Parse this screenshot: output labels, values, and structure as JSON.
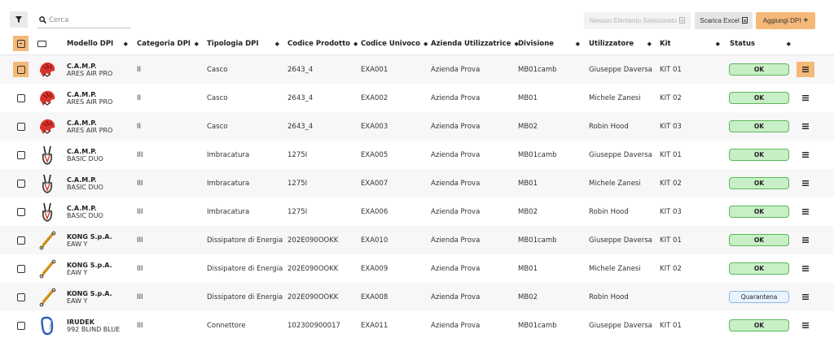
{
  "toolbar": {
    "filter_icon": "filter-icon",
    "search_placeholder": "Cerca",
    "none_selected_label": "Nessun Elemento Selezionato",
    "export_label": "Scarica Excel",
    "add_label": "Aggiungi DPI",
    "add_symbol": "+"
  },
  "columns": {
    "model": "Modello DPI",
    "category": "Categoria DPI",
    "type": "Tipologia DPI",
    "product_code": "Codice Prodotto",
    "unique_code": "Codice Univoco",
    "company": "Azienda Utilizzatrice",
    "division": "Divisione",
    "user": "Utilizzatore",
    "kit": "Kit",
    "status": "Status"
  },
  "colors": {
    "accent": "#f4b878",
    "ok_fill": "#c8efc6",
    "ok_border": "#5cb85c",
    "quarantine_fill": "#e7f3ff"
  },
  "rows": [
    {
      "thumb": "helmet",
      "brand": "C.A.M.P.",
      "name": "ARES AIR PRO",
      "category": "II",
      "type": "Casco",
      "product_code": "2643_4",
      "unique_code": "EXA001",
      "company": "Azienda Prova",
      "division": "MB01camb",
      "user": "Giuseppe Daversa",
      "kit": "KIT 01",
      "status": "OK",
      "status_kind": "ok",
      "highlight": true
    },
    {
      "thumb": "helmet",
      "brand": "C.A.M.P.",
      "name": "ARES AIR PRO",
      "category": "II",
      "type": "Casco",
      "product_code": "2643_4",
      "unique_code": "EXA002",
      "company": "Azienda Prova",
      "division": "MB01",
      "user": "Michele Zanesi",
      "kit": "KIT 02",
      "status": "OK",
      "status_kind": "ok",
      "highlight": false
    },
    {
      "thumb": "helmet",
      "brand": "C.A.M.P.",
      "name": "ARES AIR PRO",
      "category": "II",
      "type": "Casco",
      "product_code": "2643_4",
      "unique_code": "EXA003",
      "company": "Azienda Prova",
      "division": "MB02",
      "user": "Robin Hood",
      "kit": "KIT 03",
      "status": "OK",
      "status_kind": "ok",
      "highlight": false
    },
    {
      "thumb": "harness",
      "brand": "C.A.M.P.",
      "name": "BASIC DUO",
      "category": "III",
      "type": "Imbracatura",
      "product_code": "1275I",
      "unique_code": "EXA005",
      "company": "Azienda Prova",
      "division": "MB01camb",
      "user": "Giuseppe Daversa",
      "kit": "KIT 01",
      "status": "OK",
      "status_kind": "ok",
      "highlight": false
    },
    {
      "thumb": "harness",
      "brand": "C.A.M.P.",
      "name": "BASIC DUO",
      "category": "III",
      "type": "Imbracatura",
      "product_code": "1275I",
      "unique_code": "EXA007",
      "company": "Azienda Prova",
      "division": "MB01",
      "user": "Michele Zanesi",
      "kit": "KIT 02",
      "status": "OK",
      "status_kind": "ok",
      "highlight": false
    },
    {
      "thumb": "harness",
      "brand": "C.A.M.P.",
      "name": "BASIC DUO",
      "category": "III",
      "type": "Imbracatura",
      "product_code": "1275I",
      "unique_code": "EXA006",
      "company": "Azienda Prova",
      "division": "MB02",
      "user": "Robin Hood",
      "kit": "KIT 03",
      "status": "OK",
      "status_kind": "ok",
      "highlight": false
    },
    {
      "thumb": "lanyard",
      "brand": "KONG S.p.A.",
      "name": "EAW Y",
      "category": "III",
      "type": "Dissipatore di Energia",
      "product_code": "202E090OOKK",
      "unique_code": "EXA010",
      "company": "Azienda Prova",
      "division": "MB01camb",
      "user": "Giuseppe Daversa",
      "kit": "KIT 01",
      "status": "OK",
      "status_kind": "ok",
      "highlight": false
    },
    {
      "thumb": "lanyard",
      "brand": "KONG S.p.A.",
      "name": "EAW Y",
      "category": "III",
      "type": "Dissipatore di Energia",
      "product_code": "202E090OOKK",
      "unique_code": "EXA009",
      "company": "Azienda Prova",
      "division": "MB01",
      "user": "Michele Zanesi",
      "kit": "KIT 02",
      "status": "OK",
      "status_kind": "ok",
      "highlight": false
    },
    {
      "thumb": "lanyard",
      "brand": "KONG S.p.A.",
      "name": "EAW Y",
      "category": "III",
      "type": "Dissipatore di Energia",
      "product_code": "202E090OOKK",
      "unique_code": "EXA008",
      "company": "Azienda Prova",
      "division": "MB02",
      "user": "Robin Hood",
      "kit": "",
      "status": "Quarantena",
      "status_kind": "q",
      "highlight": false
    },
    {
      "thumb": "carabiner",
      "brand": "IRUDEK",
      "name": "992 BLIND BLUE",
      "category": "III",
      "type": "Connettore",
      "product_code": "102300900017",
      "unique_code": "EXA011",
      "company": "Azienda Prova",
      "division": "MB01camb",
      "user": "Giuseppe Daversa",
      "kit": "KIT 01",
      "status": "OK",
      "status_kind": "ok",
      "highlight": false
    }
  ]
}
